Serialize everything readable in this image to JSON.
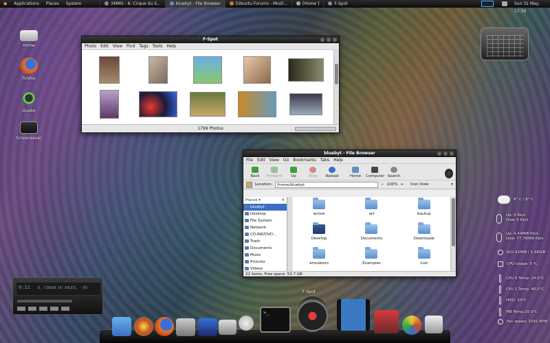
{
  "top_panel": {
    "menus": [
      "Applications",
      "Places",
      "System"
    ],
    "tasks": [
      {
        "label": "XMMS - 8. Cirque du S..."
      },
      {
        "label": "bluebyt - File Browser",
        "active": true
      },
      {
        "label": "[Ubuntu Forums - Mozil..."
      },
      {
        "label": "[Home ]"
      },
      {
        "label": "F-Spot"
      }
    ],
    "clock": "Sun 31 May, 17:39"
  },
  "desktop_icons": [
    {
      "label": "Home",
      "icon": "drive-icon"
    },
    {
      "label": "Firefox",
      "icon": "firefox-icon"
    },
    {
      "label": "Quake",
      "icon": "quake-icon"
    },
    {
      "label": "Screensaver",
      "icon": "monitor-icon"
    }
  ],
  "fspot": {
    "title": "F-Spot",
    "menu": [
      "Photo",
      "Edit",
      "View",
      "Find",
      "Tags",
      "Tools",
      "Help"
    ],
    "status": "1799 Photos"
  },
  "filebrowser": {
    "title": "bluebyt - File Browser",
    "menu": [
      "File",
      "Edit",
      "View",
      "Go",
      "Bookmarks",
      "Tabs",
      "Help"
    ],
    "toolbar": [
      "Back",
      "Forward",
      "Up",
      "Stop",
      "Reload",
      "Home",
      "Computer",
      "Search"
    ],
    "location_label": "Location:",
    "location": "/home/bluebyt",
    "zoom": "100%",
    "view_mode": "Icon View",
    "places_header": "Places",
    "places": [
      "bluebyt",
      "Desktop",
      "File System",
      "Network",
      "CD-RW/DVD...",
      "Trash",
      "Documents",
      "Music",
      "Pictures",
      "Videos"
    ],
    "files": [
      "active",
      "art",
      "backup",
      "Desktop",
      "Documents",
      "Downloads",
      "emulators",
      "Examples",
      "icon"
    ],
    "status": "22 items, Free space: 53.7 GB"
  },
  "widgets": {
    "weather": "8° C / 8° C",
    "net1_up": "Up: 0 Kb/s",
    "net1_down": "Dow: 0 Kb/s",
    "net2_up": "Up: 4.44MiB Kb/s",
    "net2_down": "Dow: 77.76MiB Kb/s",
    "memory": "602.42MiB / 1.98GiB",
    "cpu_usage": "CPU Usage:   5 %",
    "cpu0_temp": "CPU 0 Temp: 24.0°C",
    "cpu1_temp": "CPU 1 Temp: 40.0°C",
    "hdd": "HDD: 33°C",
    "mb_temp": "MB Temp:29.0°C",
    "fan": "Fan speed: 1591 RPM"
  },
  "player": {
    "time": "0:11",
    "track": "8. CIRQUE DU SOLEIL - KO"
  },
  "dock": {
    "label": "F-Spot"
  },
  "colors": {
    "accent": "#3a6fc4",
    "panel": "#1a1a1a"
  }
}
